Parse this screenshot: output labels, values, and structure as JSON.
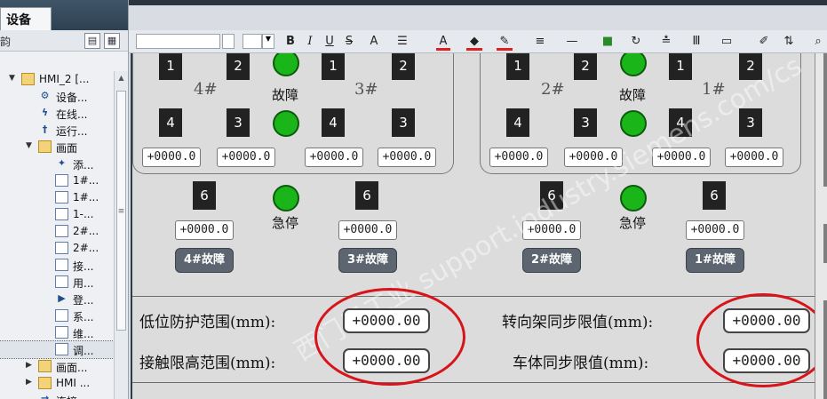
{
  "left_panel": {
    "tab_label": "设备",
    "toolbar_label": "韵",
    "tree": [
      {
        "label": "HMI_2 [...",
        "level": 0,
        "expanded": true,
        "icon": "folder-icon"
      },
      {
        "label": "设备...",
        "level": 1,
        "icon": "device-config-icon"
      },
      {
        "label": "在线...",
        "level": 1,
        "icon": "online-diagnostics-icon"
      },
      {
        "label": "运行...",
        "level": 1,
        "icon": "runtime-settings-icon"
      },
      {
        "label": "画面",
        "level": 1,
        "expanded": true,
        "icon": "folder-icon"
      },
      {
        "label": "添...",
        "level": 2,
        "icon": "add-screen-icon"
      },
      {
        "label": "1#...",
        "level": 2,
        "icon": "screen-icon"
      },
      {
        "label": "1#...",
        "level": 2,
        "icon": "screen-icon"
      },
      {
        "label": "1-...",
        "level": 2,
        "icon": "screen-icon"
      },
      {
        "label": "2#...",
        "level": 2,
        "icon": "screen-icon"
      },
      {
        "label": "2#...",
        "level": 2,
        "icon": "screen-icon"
      },
      {
        "label": "接...",
        "level": 2,
        "icon": "screen-icon"
      },
      {
        "label": "用...",
        "level": 2,
        "icon": "screen-icon"
      },
      {
        "label": "登...",
        "level": 2,
        "icon": "start-screen-icon"
      },
      {
        "label": "系...",
        "level": 2,
        "icon": "screen-icon"
      },
      {
        "label": "维...",
        "level": 2,
        "icon": "screen-icon"
      },
      {
        "label": "调...",
        "level": 2,
        "icon": "screen-icon",
        "selected": true
      },
      {
        "label": "画面...",
        "level": 1,
        "expanded": false,
        "icon": "folder-icon"
      },
      {
        "label": "HMI ...",
        "level": 1,
        "expanded": false,
        "icon": "folder-icon"
      },
      {
        "label": "连接",
        "level": 1,
        "icon": "connections-icon"
      }
    ]
  },
  "toolbar": {
    "bold": "B",
    "italic": "I",
    "underline": "U",
    "strike": "S",
    "font_color_glyph": "A",
    "text_size_glyph": "A"
  },
  "screen": {
    "groups": [
      {
        "side": "left",
        "label_a": "4#",
        "label_b": "3#",
        "lamp_label": "故障"
      },
      {
        "side": "right",
        "label_a": "2#",
        "label_b": "1#",
        "lamp_label": "故障"
      }
    ],
    "num_labels": {
      "one": "1",
      "two": "2",
      "three": "3",
      "four": "4",
      "six": "6"
    },
    "io_value": "+0000.0",
    "estop_label": "急停",
    "fault_buttons": [
      "4#故障",
      "3#故障",
      "2#故障",
      "1#故障"
    ],
    "params": [
      {
        "label": "低位防护范围(mm):",
        "value": "+0000.00"
      },
      {
        "label": "接触限高范围(mm):",
        "value": "+0000.00"
      },
      {
        "label": "转向架同步限值(mm):",
        "value": "+0000.00"
      },
      {
        "label": "车体同步限值(mm):",
        "value": "+0000.00"
      }
    ],
    "watermark": "西门子工业  support.industry.siemens.com/cs"
  },
  "colors": {
    "lamp_green": "#19b519",
    "annotation_red": "#d8141b",
    "fault_button": "#5d6670"
  }
}
